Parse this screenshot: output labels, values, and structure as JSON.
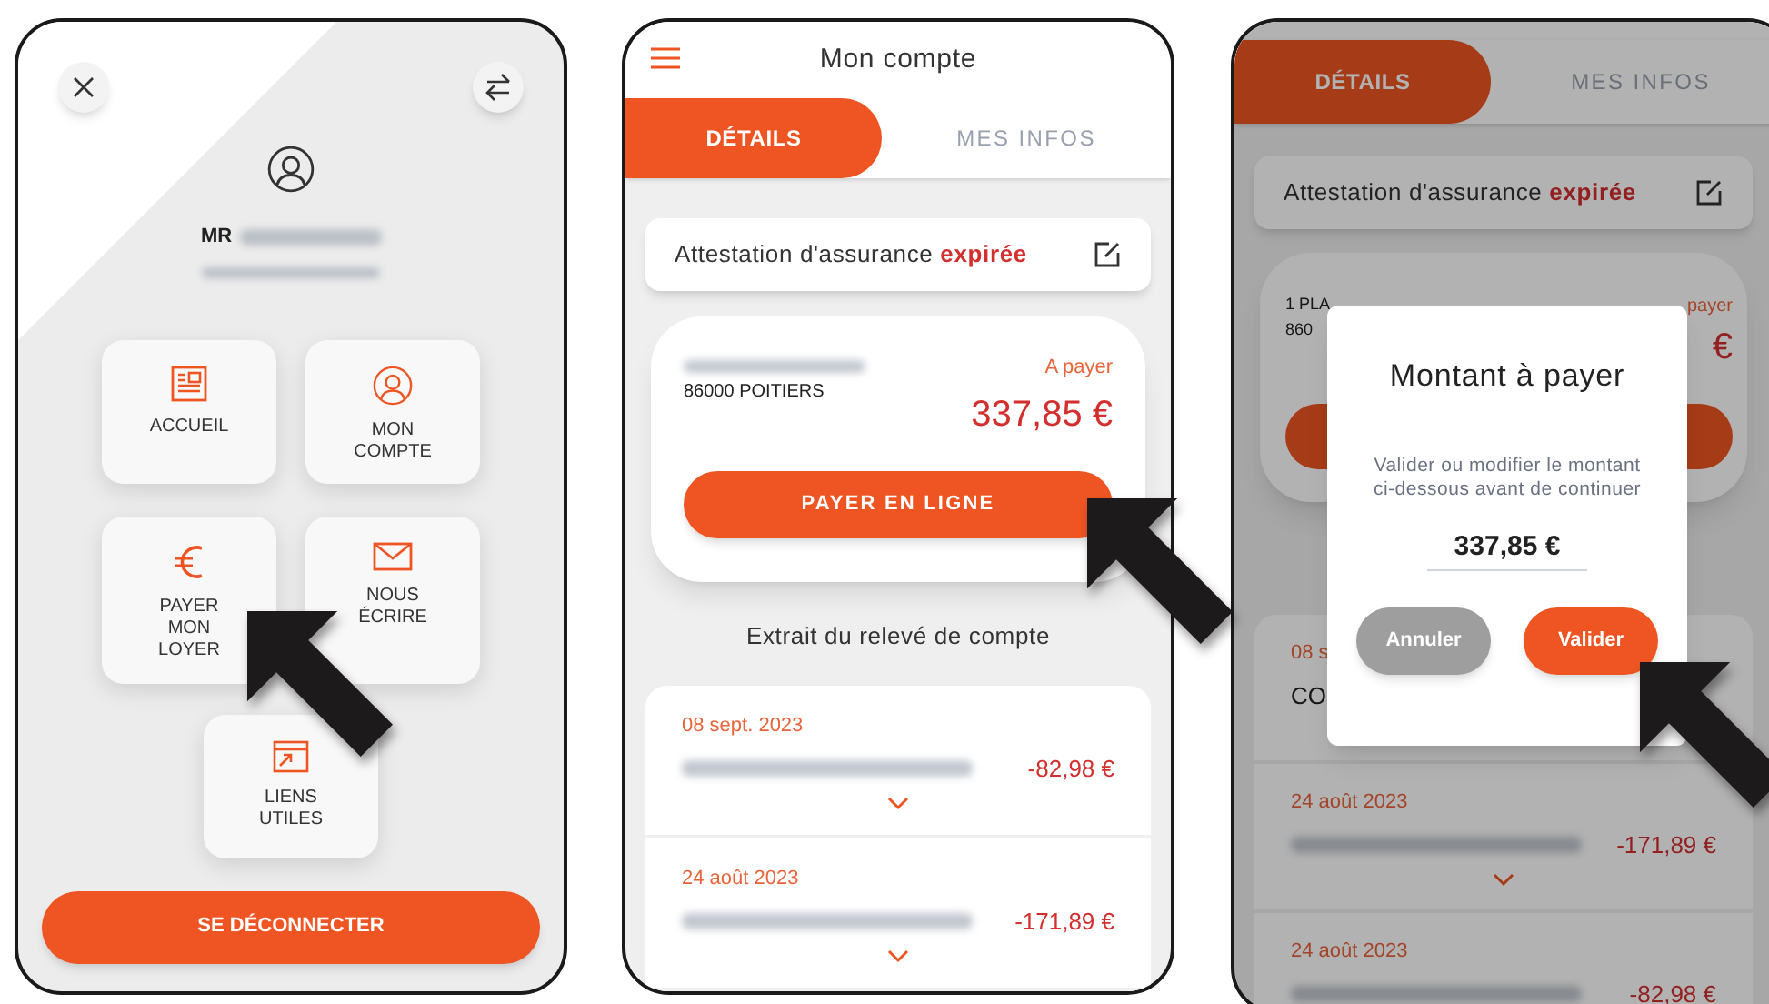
{
  "menu_screen": {
    "name_prefix": "MR",
    "tiles": [
      {
        "kind": "news",
        "label": "ACCUEIL"
      },
      {
        "kind": "user",
        "label": "MON\nCOMPTE"
      },
      {
        "kind": "euro",
        "label": "PAYER\nMON\nLOYER"
      },
      {
        "kind": "mail",
        "label": "NOUS\nÉCRIRE"
      },
      {
        "kind": "link",
        "label": "LIENS\nUTILES"
      }
    ],
    "logout_button": "SE DÉCONNECTER"
  },
  "account_screen": {
    "title": "Mon compte",
    "tabs": [
      {
        "label": "DÉTAILS",
        "selected": true
      },
      {
        "label": "MES INFOS",
        "selected": false
      }
    ],
    "insurance_notice": "Attestation d'assurance **expirée**",
    "address_line_2": "86000 POITIERS",
    "due_label": "A payer",
    "due_amount": "337,85 €",
    "pay_button": "PAYER EN LIGNE",
    "statement_title": "Extrait du relevé de compte",
    "entries": [
      {
        "date": "08 sept. 2023",
        "amount": "-82,98 €"
      },
      {
        "date": "24 août 2023",
        "amount": "-171,89 €"
      }
    ]
  },
  "dialog_screen": {
    "tabs": [
      {
        "label": "DÉTAILS",
        "selected": true
      },
      {
        "label": "MES INFOS",
        "selected": false
      }
    ],
    "insurance_notice": "Attestation d'assurance **expirée**",
    "address_line_1": "1 PLA",
    "address_line_2": "860",
    "due_label": "payer",
    "due_amount": "€",
    "entries": [
      {
        "date": "08 s",
        "description": "CO"
      },
      {
        "date": "24 août 2023",
        "amount": "-171,89 €"
      },
      {
        "date": "24 août 2023",
        "amount": "-82,98 €"
      }
    ],
    "dialog": {
      "title": "Montant à payer",
      "message": "Valider ou modifier le montant ci-dessous avant de continuer",
      "amount": "337,85 €",
      "buttons": [
        {
          "kind": "cancel",
          "label": "Annuler"
        },
        {
          "kind": "confirm",
          "label": "Valider"
        }
      ]
    }
  }
}
